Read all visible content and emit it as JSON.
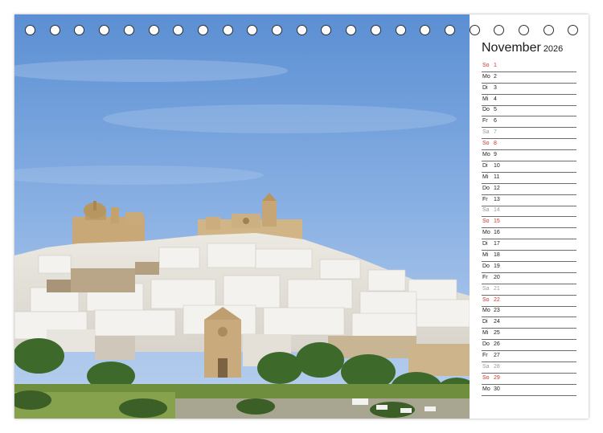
{
  "calendar": {
    "month": "November",
    "year": "2026",
    "days": [
      {
        "wd": "So",
        "num": "1",
        "type": "sun"
      },
      {
        "wd": "Mo",
        "num": "2",
        "type": "week"
      },
      {
        "wd": "Di",
        "num": "3",
        "type": "week"
      },
      {
        "wd": "Mi",
        "num": "4",
        "type": "week"
      },
      {
        "wd": "Do",
        "num": "5",
        "type": "week"
      },
      {
        "wd": "Fr",
        "num": "6",
        "type": "week"
      },
      {
        "wd": "Sa",
        "num": "7",
        "type": "sat"
      },
      {
        "wd": "So",
        "num": "8",
        "type": "sun"
      },
      {
        "wd": "Mo",
        "num": "9",
        "type": "week"
      },
      {
        "wd": "Di",
        "num": "10",
        "type": "week"
      },
      {
        "wd": "Mi",
        "num": "11",
        "type": "week"
      },
      {
        "wd": "Do",
        "num": "12",
        "type": "week"
      },
      {
        "wd": "Fr",
        "num": "13",
        "type": "week"
      },
      {
        "wd": "Sa",
        "num": "14",
        "type": "sat"
      },
      {
        "wd": "So",
        "num": "15",
        "type": "sun"
      },
      {
        "wd": "Mo",
        "num": "16",
        "type": "week"
      },
      {
        "wd": "Di",
        "num": "17",
        "type": "week"
      },
      {
        "wd": "Mi",
        "num": "18",
        "type": "week"
      },
      {
        "wd": "Do",
        "num": "19",
        "type": "week"
      },
      {
        "wd": "Fr",
        "num": "20",
        "type": "week"
      },
      {
        "wd": "Sa",
        "num": "21",
        "type": "sat"
      },
      {
        "wd": "So",
        "num": "22",
        "type": "sun"
      },
      {
        "wd": "Mo",
        "num": "23",
        "type": "week"
      },
      {
        "wd": "Di",
        "num": "24",
        "type": "week"
      },
      {
        "wd": "Mi",
        "num": "25",
        "type": "week"
      },
      {
        "wd": "Do",
        "num": "26",
        "type": "week"
      },
      {
        "wd": "Fr",
        "num": "27",
        "type": "week"
      },
      {
        "wd": "Sa",
        "num": "28",
        "type": "sat"
      },
      {
        "wd": "So",
        "num": "29",
        "type": "sun"
      },
      {
        "wd": "Mo",
        "num": "30",
        "type": "week"
      }
    ]
  },
  "colors": {
    "sunday": "#d0342c",
    "saturday": "#9a9a9a",
    "weekday": "#1a1a1a",
    "sky": "#6f9fd8"
  }
}
